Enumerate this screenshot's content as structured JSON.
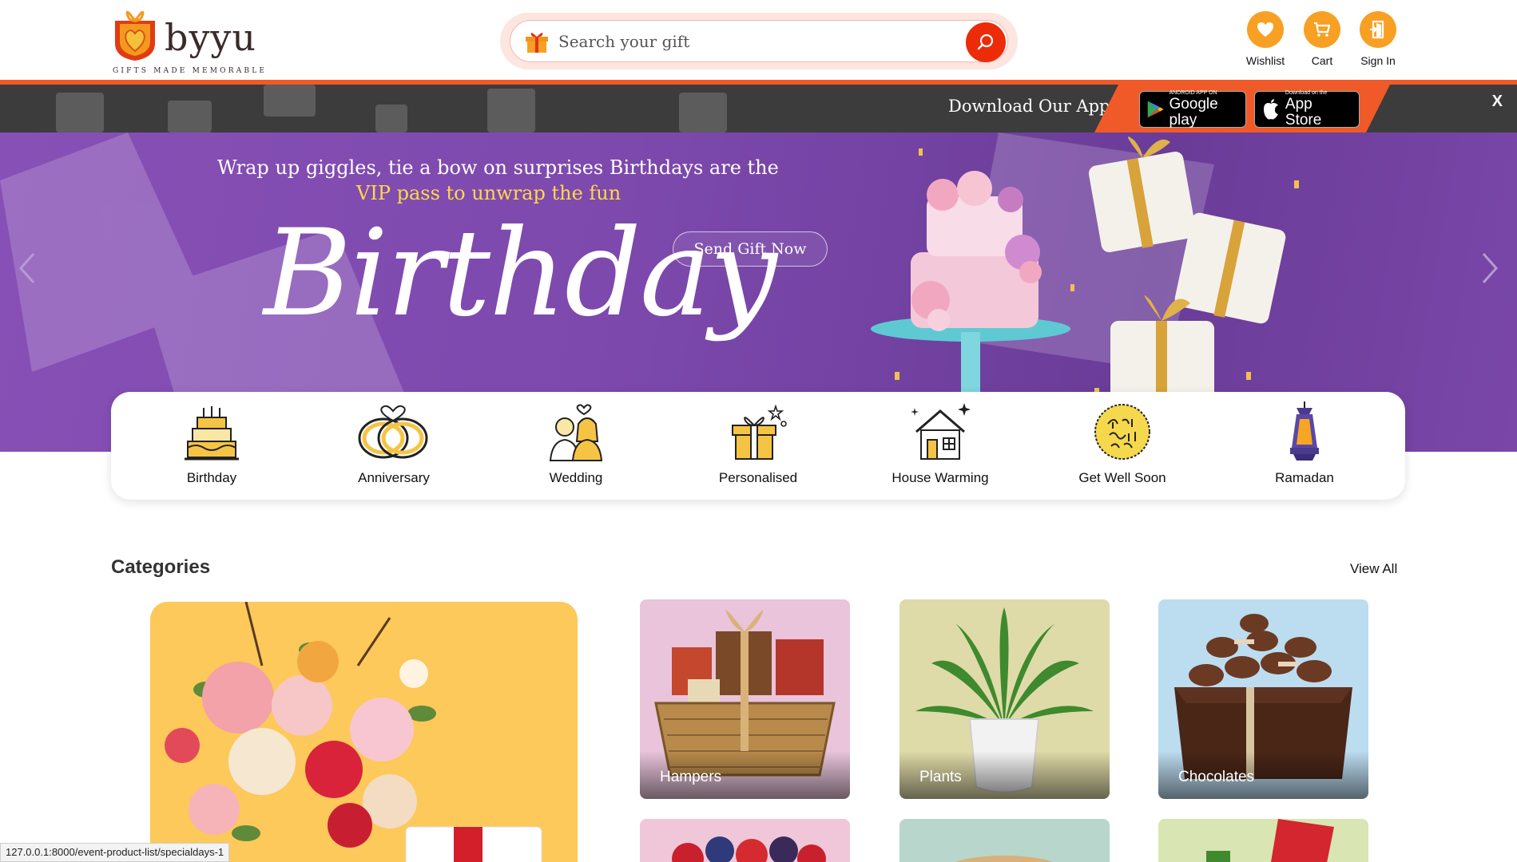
{
  "header": {
    "logo_text": "byyu",
    "logo_tagline": "GIFTS MADE MEMORABLE",
    "search_placeholder": "Search your gift",
    "icons": [
      {
        "label": "Wishlist",
        "icon": "heart-icon"
      },
      {
        "label": "Cart",
        "icon": "cart-icon"
      },
      {
        "label": "Sign In",
        "icon": "sign-in-icon"
      }
    ]
  },
  "app_banner": {
    "text": "Download Our App",
    "google_small": "ANDROID APP ON",
    "google_big": "Google play",
    "apple_small": "Download on the",
    "apple_big": "App Store",
    "close": "X"
  },
  "hero": {
    "line1": "Wrap up giggles, tie a bow on surprises Birthdays are the",
    "line2": "VIP pass to unwrap the fun",
    "script_title": "Birthday",
    "cta": "Send Gift Now"
  },
  "occasions": [
    {
      "label": "Birthday",
      "icon": "birthday-cake-icon"
    },
    {
      "label": "Anniversary",
      "icon": "rings-icon"
    },
    {
      "label": "Wedding",
      "icon": "couple-icon"
    },
    {
      "label": "Personalised",
      "icon": "gift-box-icon"
    },
    {
      "label": "House Warming",
      "icon": "house-icon"
    },
    {
      "label": "Get Well Soon",
      "icon": "get-well-soon-icon"
    },
    {
      "label": "Ramadan",
      "icon": "lantern-icon"
    }
  ],
  "categories": {
    "title": "Categories",
    "view_all": "View All",
    "tiles": [
      {
        "label": "Hampers"
      },
      {
        "label": "Plants"
      },
      {
        "label": "Chocolates"
      }
    ]
  },
  "status_url": "127.0.0.1:8000/event-product-list/specialdays-1",
  "colors": {
    "brand_orange": "#f05a28",
    "accent_orange": "#f7a023",
    "search_red": "#ec2b08",
    "hero_purple": "#7d49ad",
    "highlight_yellow": "#ffd84a"
  }
}
